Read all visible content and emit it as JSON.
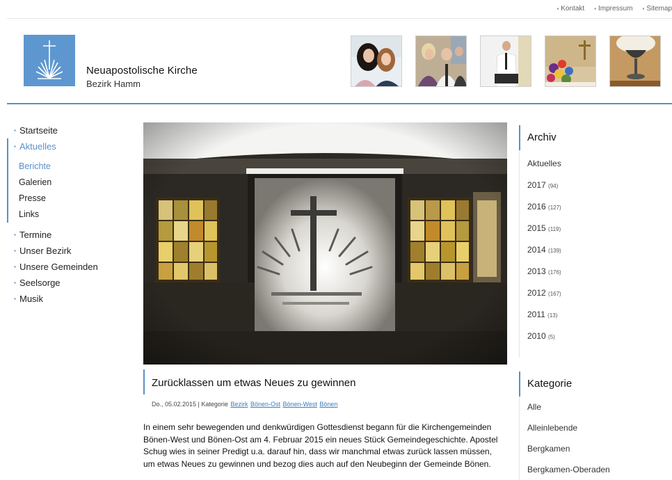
{
  "topnav": [
    {
      "label": "Kontakt"
    },
    {
      "label": "Impressum"
    },
    {
      "label": "Sitemap"
    }
  ],
  "brand": {
    "name": "Neuapostolische Kirche",
    "subtitle": "Bezirk Hamm"
  },
  "colors": {
    "accent": "#5b8fc7",
    "logo_bg": "#5e97cf"
  },
  "header_images": [
    {
      "name": "two-girls-photo"
    },
    {
      "name": "congregation-photo"
    },
    {
      "name": "preacher-photo"
    },
    {
      "name": "altar-flowers-photo"
    },
    {
      "name": "chalice-photo"
    }
  ],
  "leftnav": {
    "items": [
      {
        "label": "Startseite"
      },
      {
        "label": "Aktuelles"
      },
      {
        "label": "Termine"
      },
      {
        "label": "Unser Bezirk"
      },
      {
        "label": "Unsere Gemeinden"
      },
      {
        "label": "Seelsorge"
      },
      {
        "label": "Musik"
      }
    ],
    "sub_items": [
      {
        "label": "Berichte"
      },
      {
        "label": "Galerien"
      },
      {
        "label": "Presse"
      },
      {
        "label": "Links"
      }
    ]
  },
  "article": {
    "title": "Zurücklassen um etwas Neues zu gewinnen",
    "meta_prefix": "Do., 05.02.2015 | Kategorie",
    "categories": [
      "Bezirk",
      "Bönen-Ost",
      "Bönen-West",
      "Bönen"
    ],
    "body": "In einem sehr bewegenden und denkwürdigen Gottesdienst begann für die Kirchengemeinden Bönen-West und Bönen-Ost am 4. Februar 2015 ein neues Stück Gemeindegeschichte. Apostel Schug wies in seiner Predigt u.a. darauf hin, dass wir manchmal etwas zurück lassen müssen, um etwas Neues zu gewinnen und bezog dies auch auf den Neubeginn der Gemeinde Bönen."
  },
  "archive": {
    "title": "Archiv",
    "items": [
      {
        "label": "Aktuelles",
        "count": ""
      },
      {
        "label": "2017",
        "count": "(94)"
      },
      {
        "label": "2016",
        "count": "(127)"
      },
      {
        "label": "2015",
        "count": "(119)"
      },
      {
        "label": "2014",
        "count": "(139)"
      },
      {
        "label": "2013",
        "count": "(176)"
      },
      {
        "label": "2012",
        "count": "(167)"
      },
      {
        "label": "2011",
        "count": "(13)"
      },
      {
        "label": "2010",
        "count": "(5)"
      }
    ]
  },
  "kategorie": {
    "title": "Kategorie",
    "items": [
      {
        "label": "Alle"
      },
      {
        "label": "Alleinlebende"
      },
      {
        "label": "Bergkamen"
      },
      {
        "label": "Bergkamen-Oberaden"
      }
    ]
  }
}
